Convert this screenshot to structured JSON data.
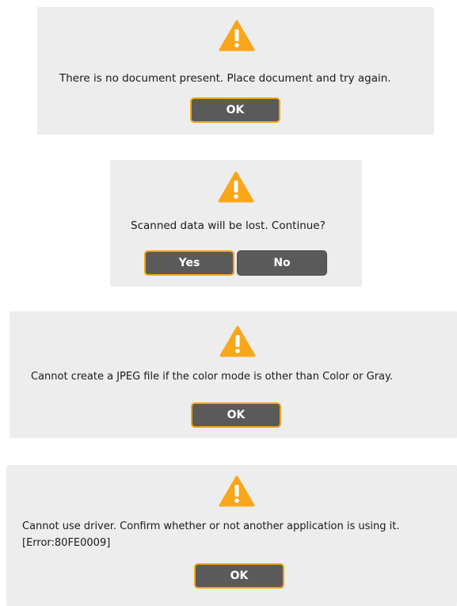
{
  "dialogs": [
    {
      "icon": "warning-icon",
      "message": "There is no document present. Place document and try again.",
      "buttons": {
        "ok": "OK"
      }
    },
    {
      "icon": "warning-icon",
      "message": "Scanned data will be lost. Continue?",
      "buttons": {
        "yes": "Yes",
        "no": "No"
      }
    },
    {
      "icon": "warning-icon",
      "message": "Cannot create a JPEG file if the color mode is other than Color or Gray.",
      "buttons": {
        "ok": "OK"
      }
    },
    {
      "icon": "warning-icon",
      "message_lines": [
        "Cannot use driver. Confirm whether or not another application is using it.",
        "[Error:80FE0009]"
      ],
      "buttons": {
        "ok": "OK"
      }
    }
  ],
  "colors": {
    "dialog_background": "#ededed",
    "button_background": "#5a5a5a",
    "default_button_border": "#f2a417",
    "warning_fill": "#f9a61a"
  }
}
